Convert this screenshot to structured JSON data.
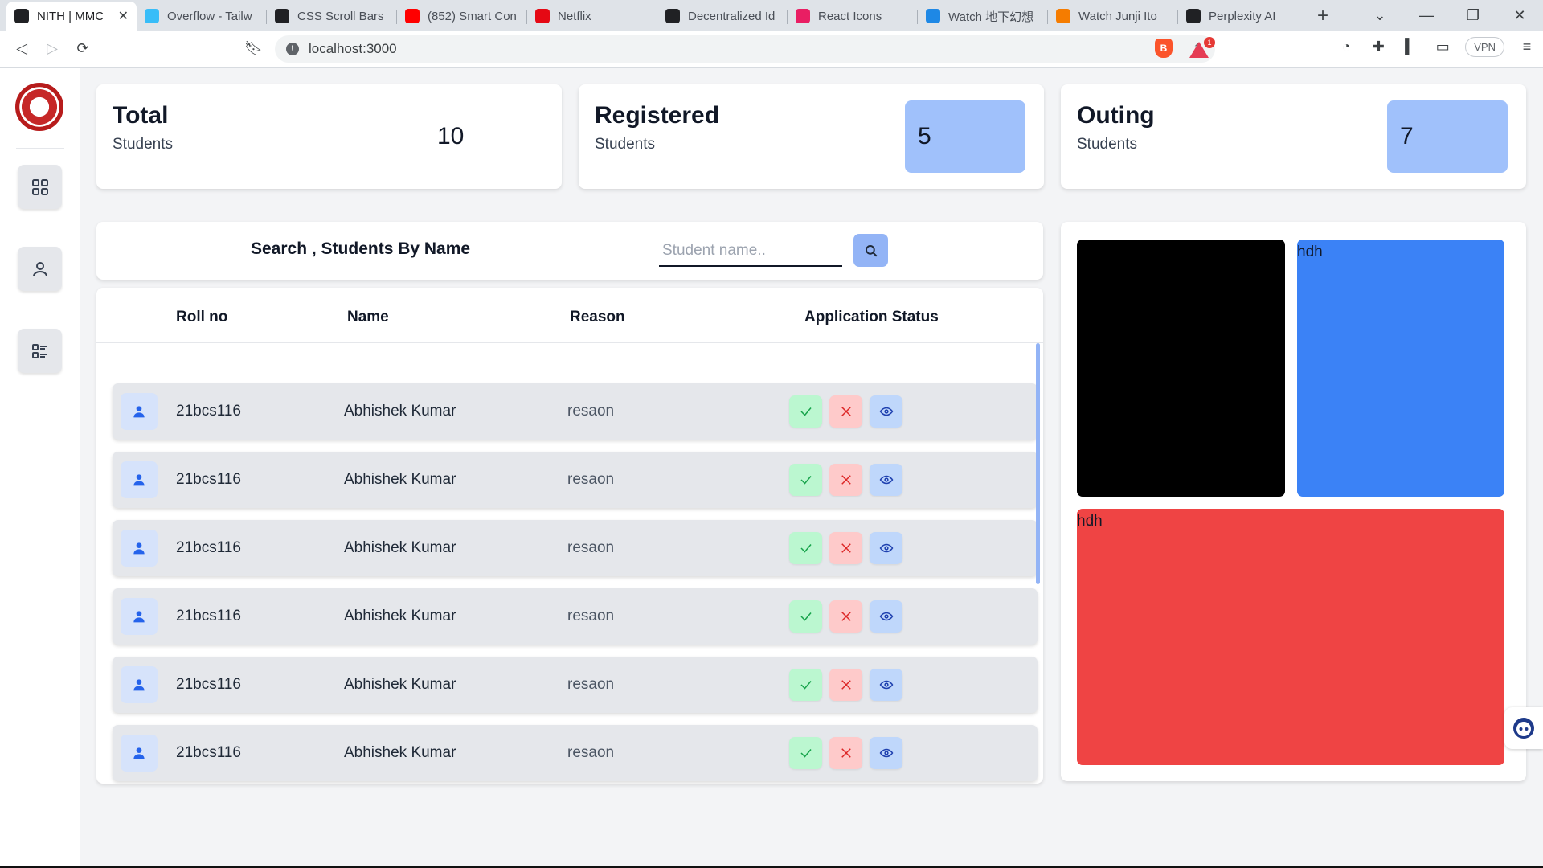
{
  "browser": {
    "tabs": [
      {
        "title": "NITH | MMC",
        "active": true,
        "favicon_color": "#202124",
        "icon": "app-icon"
      },
      {
        "title": "Overflow - Tailw",
        "active": false,
        "favicon_color": "#38bdf8",
        "icon": "tailwind-icon"
      },
      {
        "title": "CSS Scroll Bars",
        "active": false,
        "favicon_color": "#202124",
        "icon": "codepen-icon"
      },
      {
        "title": "(852) Smart Con",
        "active": false,
        "favicon_color": "#ff0000",
        "icon": "youtube-icon"
      },
      {
        "title": "Netflix",
        "active": false,
        "favicon_color": "#e50914",
        "icon": "netflix-icon"
      },
      {
        "title": "Decentralized Id",
        "active": false,
        "favicon_color": "#202124",
        "icon": "doc-icon"
      },
      {
        "title": "React Icons",
        "active": false,
        "favicon_color": "#e91e63",
        "icon": "react-icon"
      },
      {
        "title": "Watch 地下幻想",
        "active": false,
        "favicon_color": "#1e88e5",
        "icon": "video-icon"
      },
      {
        "title": "Watch Junji Ito",
        "active": false,
        "favicon_color": "#f57c00",
        "icon": "crunchyroll-icon"
      },
      {
        "title": "Perplexity AI",
        "active": false,
        "favicon_color": "#202124",
        "icon": "perplexity-icon"
      }
    ],
    "url": "localhost:3000",
    "vpn_label": "VPN",
    "rewards_badge": "1"
  },
  "stats": {
    "total": {
      "title": "Total",
      "subtitle": "Students",
      "value": "10"
    },
    "registered": {
      "title": "Registered",
      "subtitle": "Students",
      "value": "5"
    },
    "outing": {
      "title": "Outing",
      "subtitle": "Students",
      "value": "7"
    }
  },
  "search": {
    "title": "Search , Students By Name",
    "placeholder": "Student name.."
  },
  "table": {
    "headers": {
      "roll": "Roll no",
      "name": "Name",
      "reason": "Reason",
      "status": "Application Status"
    },
    "rows": [
      {
        "roll": "21bcs116",
        "name": "Abhishek Kumar",
        "reason": "resaon"
      },
      {
        "roll": "21bcs116",
        "name": "Abhishek Kumar",
        "reason": "resaon"
      },
      {
        "roll": "21bcs116",
        "name": "Abhishek Kumar",
        "reason": "resaon"
      },
      {
        "roll": "21bcs116",
        "name": "Abhishek Kumar",
        "reason": "resaon"
      },
      {
        "roll": "21bcs116",
        "name": "Abhishek Kumar",
        "reason": "resaon"
      },
      {
        "roll": "21bcs116",
        "name": "Abhishek Kumar",
        "reason": "resaon"
      }
    ]
  },
  "tiles": {
    "black": {
      "label": "",
      "color": "#000000"
    },
    "blue": {
      "label": "hdh",
      "color": "#3b82f6"
    },
    "red": {
      "label": "hdh",
      "color": "#ef4444"
    }
  },
  "colors": {
    "accent": "#93b4f6",
    "stat_box": "#a0c1fb",
    "approve": "#bbf7d0",
    "reject": "#fecaca",
    "view": "#bfd7fb"
  }
}
